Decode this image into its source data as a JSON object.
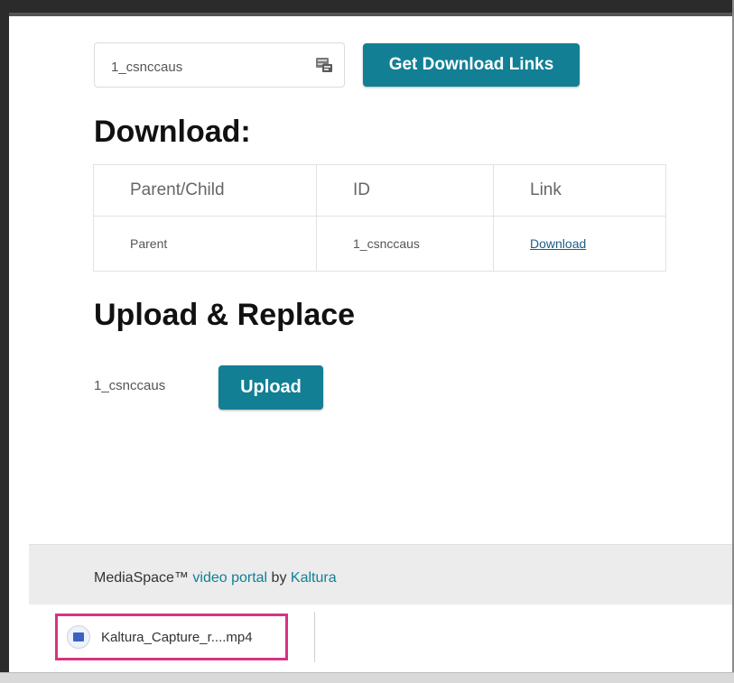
{
  "entry_input": {
    "value": "1_csnccaus"
  },
  "get_links_button": {
    "label": "Get Download Links"
  },
  "download_section": {
    "heading": "Download:",
    "table": {
      "headers": [
        "Parent/Child",
        "ID",
        "Link"
      ],
      "rows": [
        {
          "type": "Parent",
          "id": "1_csnccaus",
          "link": "Download"
        }
      ]
    }
  },
  "upload_section": {
    "heading": "Upload & Replace",
    "entry_id": "1_csnccaus",
    "upload_button": "Upload"
  },
  "footer": {
    "prefix": "MediaSpace™ ",
    "link1": "video portal",
    "middle": " by ",
    "link2": "Kaltura"
  },
  "download_shelf": {
    "filename": "Kaltura_Capture_r....mp4",
    "icon": "video-file-icon",
    "highlight_color": "#d63384"
  },
  "colors": {
    "accent": "#127f95",
    "link": "#1a5e88"
  }
}
